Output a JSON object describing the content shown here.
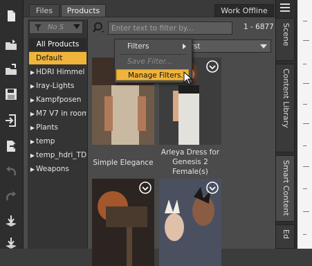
{
  "tabs": {
    "files": "Files",
    "products": "Products",
    "work_offline": "Work Offline"
  },
  "category_filter": {
    "placeholder": "No S",
    "icon": "funnel-icon"
  },
  "categories": [
    {
      "label": "All Products",
      "arrow": "",
      "selected": false
    },
    {
      "label": "Default",
      "arrow": "",
      "selected": true
    },
    {
      "label": "HDRI Himmel",
      "arrow": "▶",
      "selected": false
    },
    {
      "label": "Iray-Lights",
      "arrow": "▶",
      "selected": false
    },
    {
      "label": "Kampfposen",
      "arrow": "▶",
      "selected": false
    },
    {
      "label": "M7 V7 in room",
      "arrow": "▶",
      "selected": false
    },
    {
      "label": "Plants",
      "arrow": "▶",
      "selected": false
    },
    {
      "label": "temp",
      "arrow": "▶",
      "selected": false
    },
    {
      "label": "temp_hdri_TD",
      "arrow": "▶",
      "selected": false
    },
    {
      "label": "Weapons",
      "arrow": "▶",
      "selected": false
    }
  ],
  "search": {
    "placeholder": "Enter text to filter by...",
    "count": "1 - 6877"
  },
  "sort": {
    "label": "cent First"
  },
  "menu": {
    "filters": "Filters",
    "save_filter": "Save Filter...",
    "manage_filters": "Manage Filters..."
  },
  "products": [
    {
      "name": "Simple Elegance",
      "color": "#8a8a8a"
    },
    {
      "name": "Arleya Dress for Genesis 2 Female(s)",
      "color": "#8a8a8a"
    },
    {
      "name": "",
      "color": "#6a4a3a"
    },
    {
      "name": "",
      "color": "#556070"
    }
  ],
  "side_tabs": [
    "Scene",
    "Content Library",
    "Smart Content",
    "Ed"
  ],
  "colors": {
    "accent": "#f0b43a"
  }
}
